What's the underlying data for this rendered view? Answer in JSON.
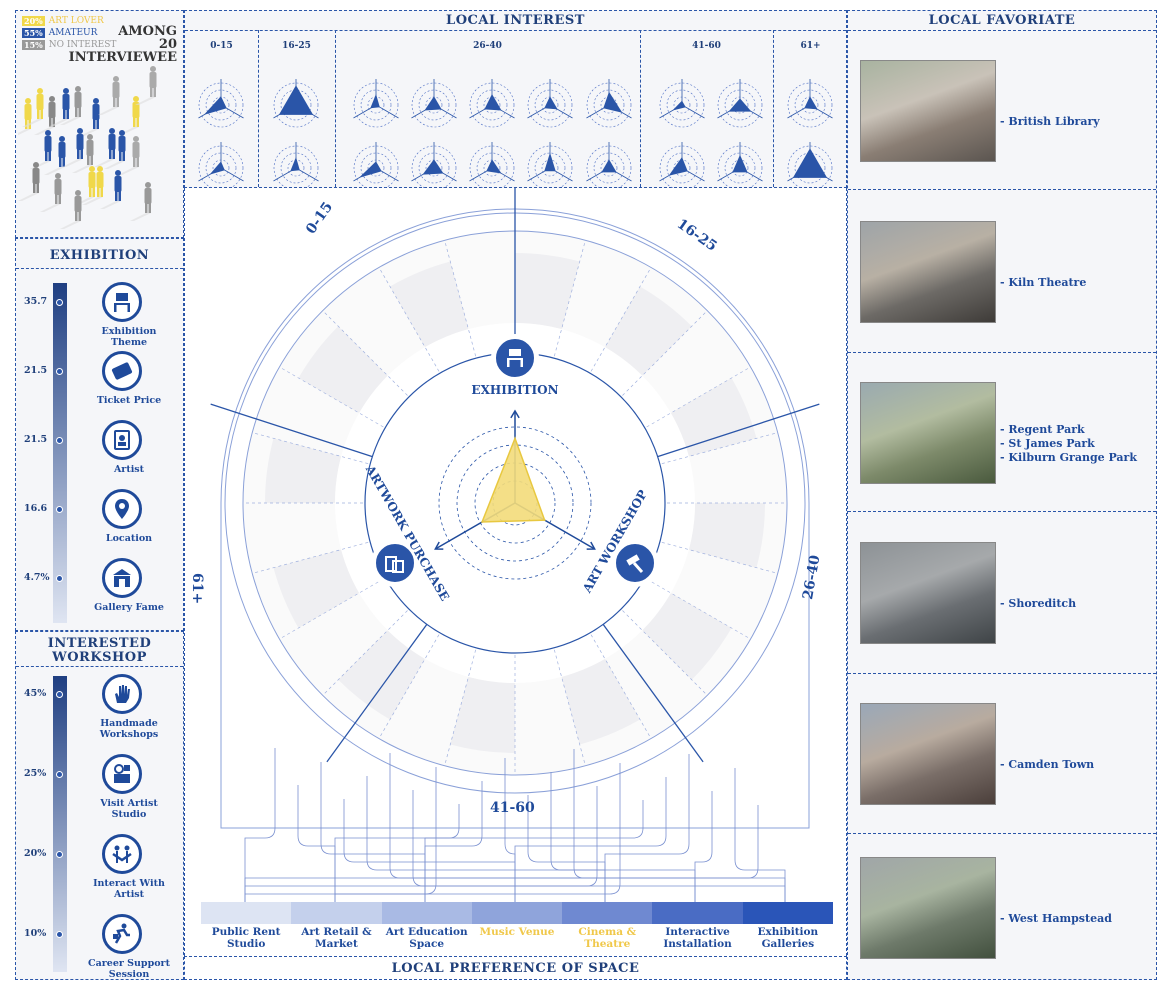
{
  "legend": {
    "items": [
      {
        "pct": "20%",
        "label": "ART LOVER",
        "color": "#f0d84a"
      },
      {
        "pct": "55%",
        "label": "AMATEUR",
        "color": "#2a55a8"
      },
      {
        "pct": "15%",
        "label": "NO INTEREST",
        "color": "#999999"
      }
    ],
    "among": "AMONG",
    "count": "20",
    "interviewee": "INTERVIEWEE"
  },
  "exhibition": {
    "title": "EXHIBITION",
    "items": [
      {
        "value": "35.7",
        "label1": "Exhibition",
        "label2": "Theme",
        "icon": "exhibition-theme-icon"
      },
      {
        "value": "21.5",
        "label1": "Ticket Price",
        "label2": "",
        "icon": "ticket-icon"
      },
      {
        "value": "21.5",
        "label1": "Artist",
        "label2": "",
        "icon": "artist-icon"
      },
      {
        "value": "16.6",
        "label1": "Location",
        "label2": "",
        "icon": "location-pin-icon"
      },
      {
        "value": "4.7%",
        "label1": "Gallery Fame",
        "label2": "",
        "icon": "gallery-icon"
      }
    ]
  },
  "workshop": {
    "title1": "INTERESTED",
    "title2": "WORKSHOP",
    "items": [
      {
        "value": "45%",
        "label1": "Handmade",
        "label2": "Workshops",
        "icon": "hand-icon"
      },
      {
        "value": "25%",
        "label1": "Visit Artist Studio",
        "label2": "",
        "icon": "studio-icon"
      },
      {
        "value": "20%",
        "label1": "Interact With",
        "label2": "Artist",
        "icon": "interact-icon"
      },
      {
        "value": "10%",
        "label1": "Career Support",
        "label2": "Session",
        "icon": "career-icon"
      }
    ]
  },
  "interest": {
    "title": "LOCAL INTEREST",
    "ages": [
      "0-15",
      "16-25",
      "26-40",
      "41-60",
      "61+"
    ]
  },
  "center": {
    "sectors": [
      "0-15",
      "16-25",
      "26-40",
      "41-60",
      "61+"
    ],
    "axes": [
      "EXHIBITION",
      "ARTWORK PURCHASE",
      "ART WORKSHOP"
    ]
  },
  "space": {
    "title": "LOCAL PREFERENCE OF SPACE",
    "items": [
      {
        "label1": "Public Rent",
        "label2": "Studio",
        "color": "#dde4f3",
        "text": "#1f4a9a"
      },
      {
        "label1": "Art Retail &",
        "label2": "Market",
        "color": "#c4d0ec",
        "text": "#1f4a9a"
      },
      {
        "label1": "Art Education",
        "label2": "Space",
        "color": "#a9bae4",
        "text": "#1f4a9a"
      },
      {
        "label1": "Music Venue",
        "label2": "",
        "color": "#8fa4db",
        "text": "#f0c84a"
      },
      {
        "label1": "Cinema &",
        "label2": "Theatre",
        "color": "#6f89d1",
        "text": "#f0c84a"
      },
      {
        "label1": "Interactive",
        "label2": "Installation",
        "color": "#4a6cc4",
        "text": "#1f4a9a"
      },
      {
        "label1": "Exhibition",
        "label2": "Galleries",
        "color": "#2a55b8",
        "text": "#1f4a9a"
      }
    ]
  },
  "favorite": {
    "title": "LOCAL FAVORIATE",
    "places": [
      {
        "names": [
          "- British Library"
        ]
      },
      {
        "names": [
          "- Kiln Theatre"
        ]
      },
      {
        "names": [
          "- Regent Park",
          "- St James Park",
          "- Kilburn Grange Park"
        ]
      },
      {
        "names": [
          "- Shoreditch"
        ]
      },
      {
        "names": [
          "- Camden Town"
        ]
      },
      {
        "names": [
          "- West Hampstead"
        ]
      }
    ]
  }
}
